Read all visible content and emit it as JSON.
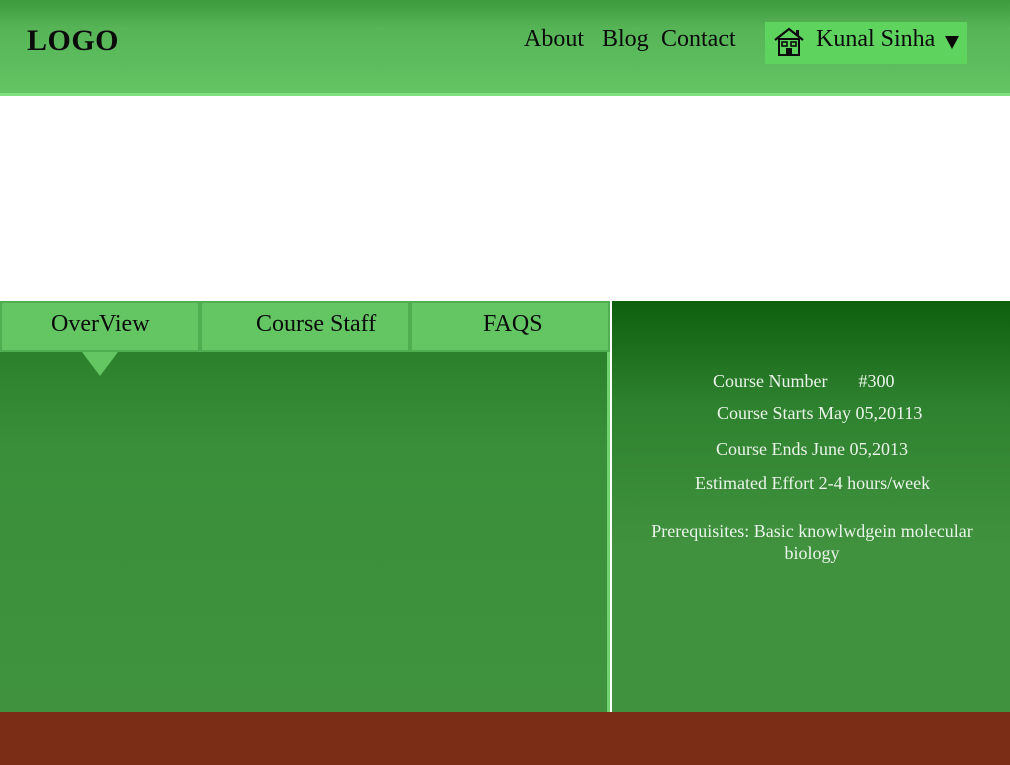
{
  "header": {
    "logo": "LOGO",
    "nav": [
      {
        "label": "About"
      },
      {
        "label": "Blog"
      },
      {
        "label": "Contact"
      }
    ],
    "user": {
      "name": "Kunal Sinha",
      "icon": "home-icon",
      "caret_icon": "caret-down-icon"
    }
  },
  "tabs": [
    {
      "label": "OverView",
      "active": true
    },
    {
      "label": "Course Staff"
    },
    {
      "label": "FAQS"
    }
  ],
  "course_info": {
    "number_label": "Course Number",
    "number_value": "#300",
    "starts": "Course Starts May 05,20113",
    "ends": "Course Ends June 05,2013",
    "effort": "Estimated Effort 2-4 hours/week",
    "prerequisites": "Prerequisites: Basic knowlwdgein molecular biology"
  },
  "colors": {
    "header_green": "#5fc35f",
    "user_menu_green": "#5ed35e",
    "tab_green": "#63c663",
    "panel_green": "#40923e",
    "panel_dark_green": "#0e5f0e",
    "footer_brown": "#7b2d16"
  }
}
